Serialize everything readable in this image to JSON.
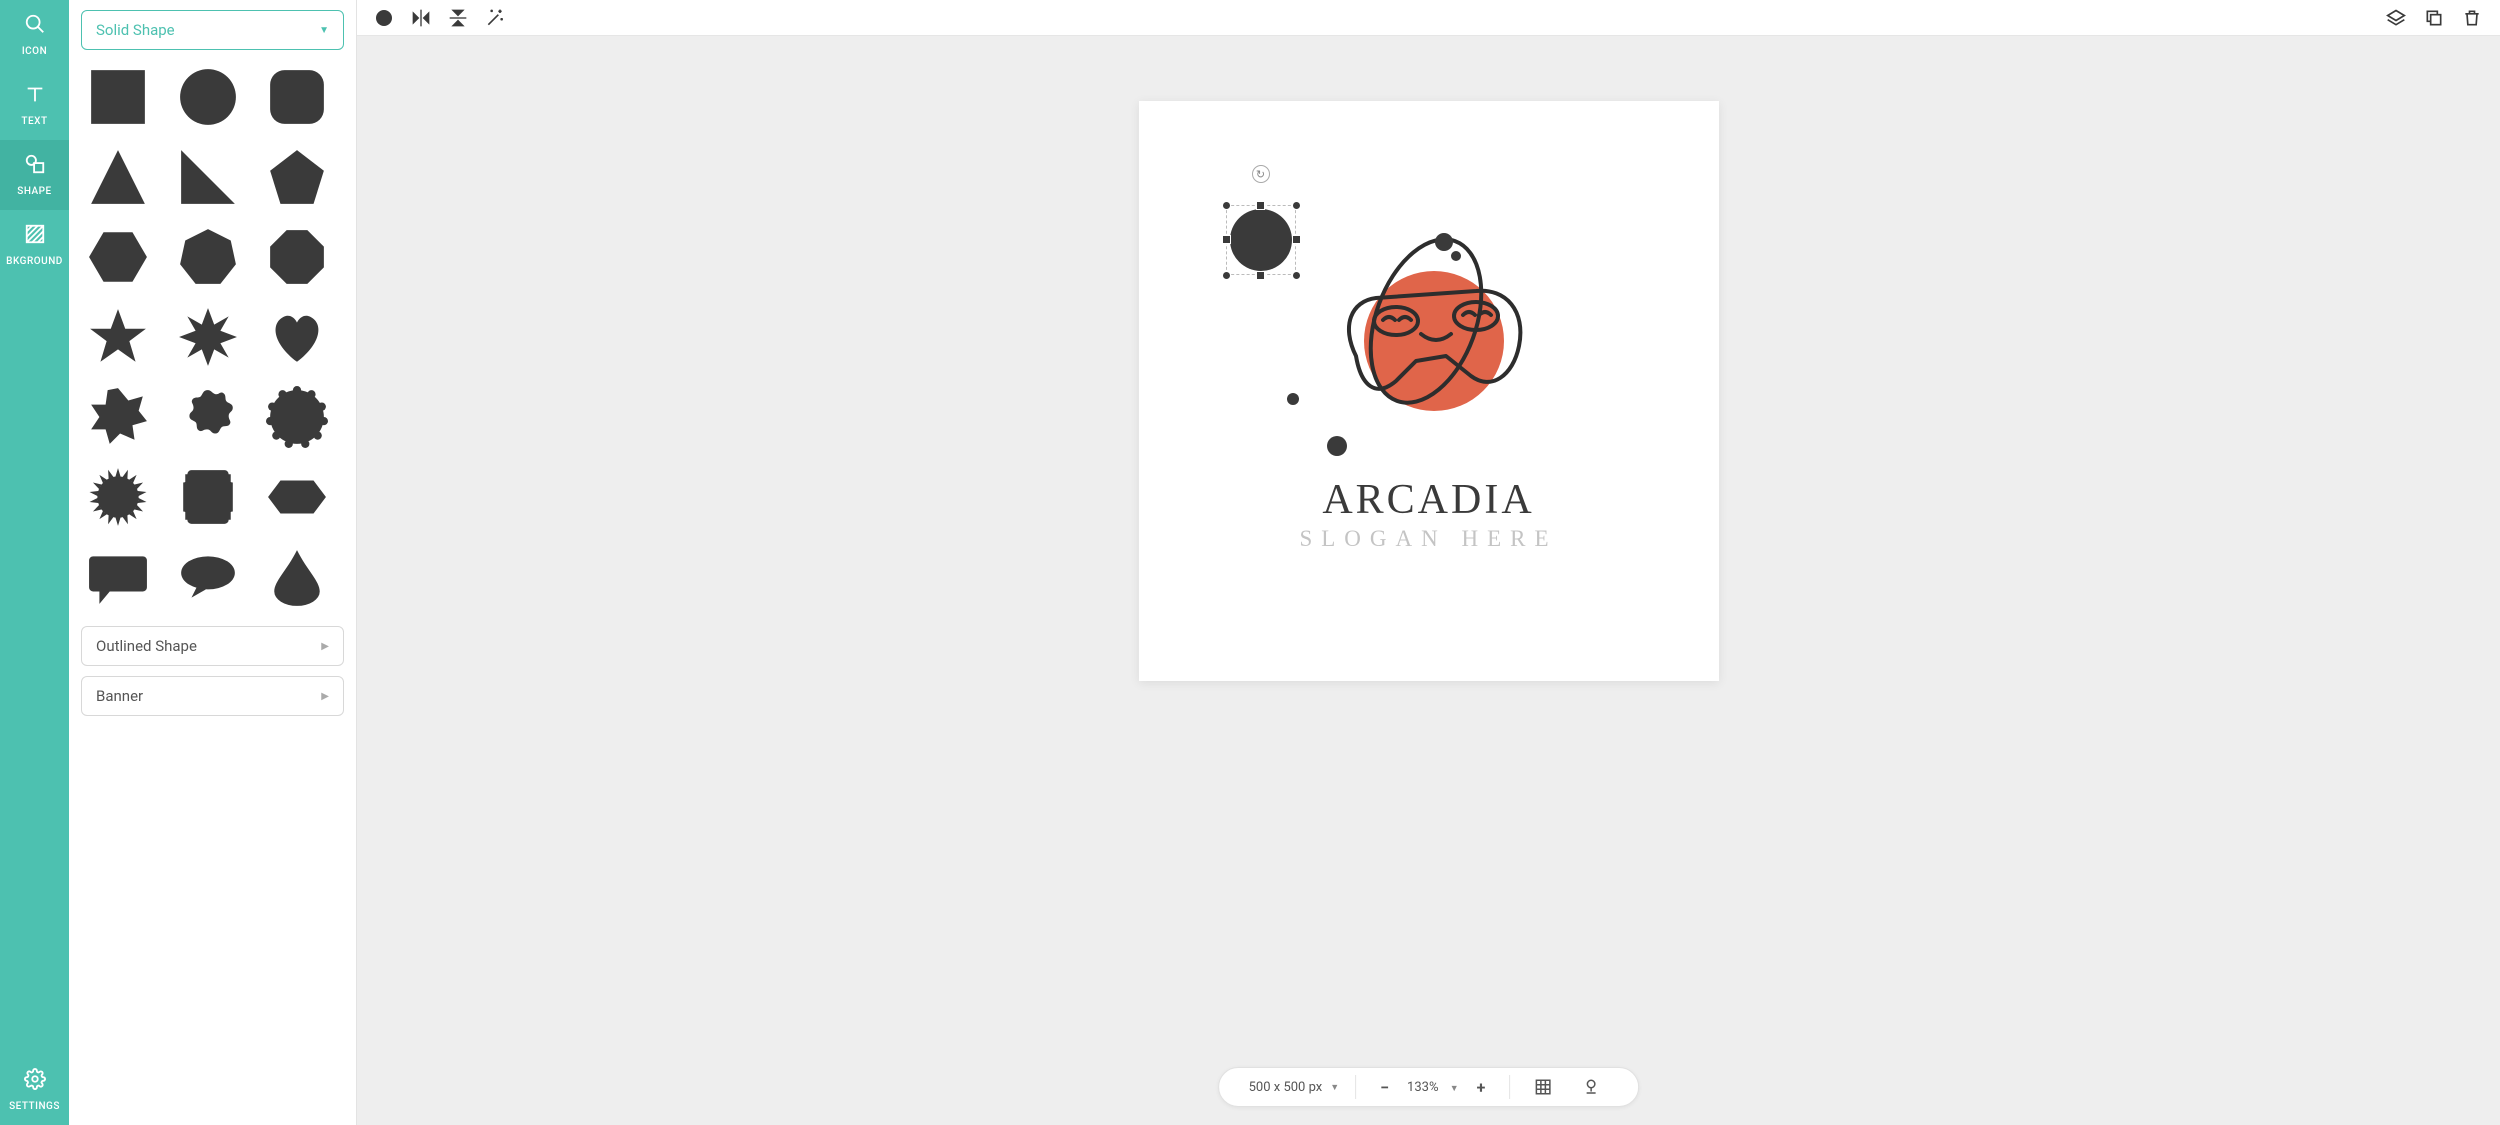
{
  "sidebar": {
    "items": [
      {
        "label": "ICON"
      },
      {
        "label": "TEXT"
      },
      {
        "label": "SHAPE"
      },
      {
        "label": "BKGROUND"
      },
      {
        "label": "SETTINGS"
      }
    ],
    "active_index": 2
  },
  "shapes_panel": {
    "dropdown_solid": "Solid Shape",
    "dropdown_outlined": "Outlined Shape",
    "dropdown_banner": "Banner",
    "shapes": [
      "square",
      "circle",
      "rounded-square",
      "triangle",
      "right-triangle",
      "pentagon",
      "hexagon",
      "heptagon",
      "octagon",
      "star-5",
      "star-8",
      "heart",
      "burst-8",
      "scallop-12",
      "scallop-20",
      "seal-burst",
      "stamp-frame",
      "hexagon-wide",
      "speech-rect",
      "speech-oval",
      "drop"
    ]
  },
  "topbar": {
    "fill_color": "#3a3a3a"
  },
  "canvas": {
    "title": "ARCADIA",
    "subtitle": "SLOGAN HERE",
    "accent_color": "#e0654a",
    "selected_shape": "circle"
  },
  "bottombar": {
    "dimensions": "500 x 500 px",
    "zoom": "133%"
  }
}
